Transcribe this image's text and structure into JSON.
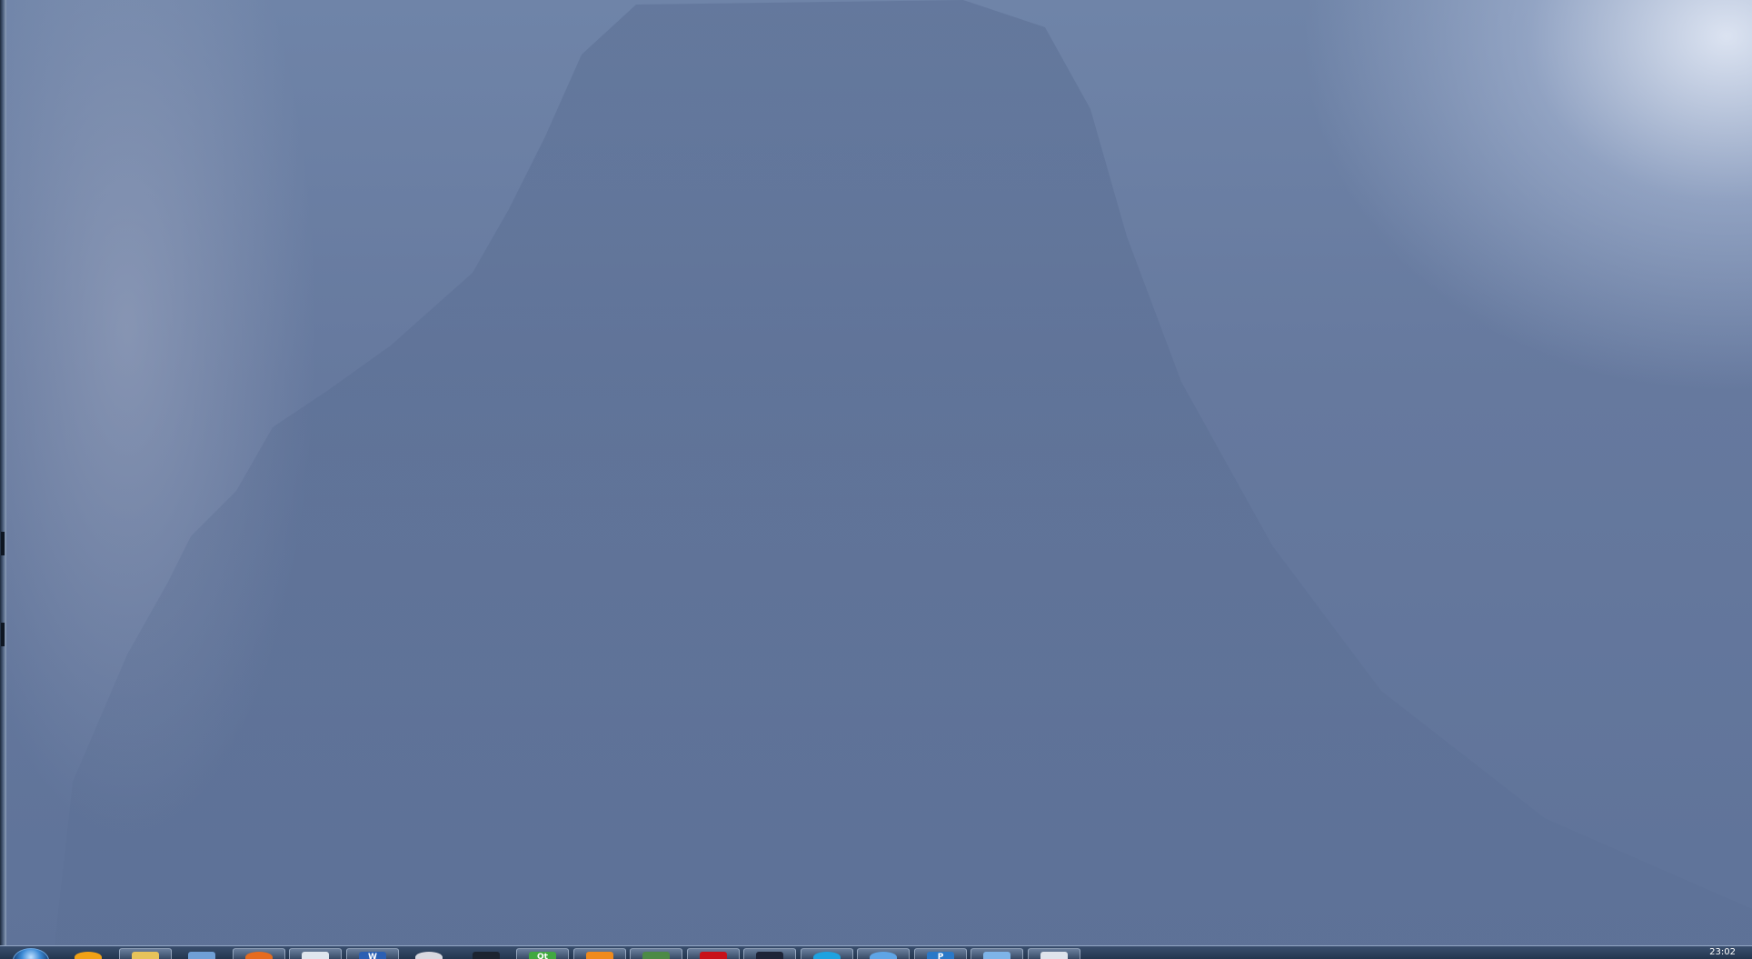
{
  "desktop": {
    "wallpaper": "blue-textured-mountain-fog"
  },
  "taskbar": {
    "start_button": {
      "icon": "windows-orb-icon"
    },
    "items": [
      {
        "name": "internet-explorer",
        "icon": "internet-explorer-icon",
        "color": "#f2a116",
        "active": false
      },
      {
        "name": "windows-explorer",
        "icon": "folder-icon",
        "color": "#e7c35a",
        "active": true
      },
      {
        "name": "document-folder",
        "icon": "folder-document-icon",
        "color": "#6f9fd6",
        "active": false
      },
      {
        "name": "firefox",
        "icon": "firefox-icon",
        "color": "#e66b1f",
        "active": true
      },
      {
        "name": "notepad",
        "icon": "notepad-icon",
        "color": "#dfe6ee",
        "active": true
      },
      {
        "name": "word",
        "icon": "word-icon",
        "color": "#2b5fb3",
        "active": true,
        "glyph": "W"
      },
      {
        "name": "itunes",
        "icon": "itunes-icon",
        "color": "#d8d8e0",
        "active": false
      },
      {
        "name": "pen-tool",
        "icon": "pen-icon",
        "color": "#1c2430",
        "active": false
      },
      {
        "name": "qt-creator",
        "icon": "qt-icon",
        "color": "#41a841",
        "active": true,
        "glyph": "Qt"
      },
      {
        "name": "vlc",
        "icon": "vlc-cone-icon",
        "color": "#f08a1c",
        "active": true
      },
      {
        "name": "spreadsheet",
        "icon": "spreadsheet-icon",
        "color": "#4c8a46",
        "active": true
      },
      {
        "name": "pdf-reader",
        "icon": "pdf-icon",
        "color": "#c8121a",
        "active": true
      },
      {
        "name": "terminal",
        "icon": "terminal-icon",
        "color": "#1e2438",
        "active": true
      },
      {
        "name": "skype",
        "icon": "skype-icon",
        "color": "#1ea2e0",
        "active": true
      },
      {
        "name": "messenger",
        "icon": "messenger-icon",
        "color": "#5fa5e6",
        "active": true
      },
      {
        "name": "photoshop",
        "icon": "photoshop-icon",
        "color": "#2a78c8",
        "active": true,
        "glyph": "P"
      },
      {
        "name": "mail",
        "icon": "mail-icon",
        "color": "#7eb4e8",
        "active": true
      },
      {
        "name": "window",
        "icon": "window-icon",
        "color": "#dfe4ec",
        "active": true
      }
    ],
    "clock": {
      "time": "23:02"
    }
  }
}
